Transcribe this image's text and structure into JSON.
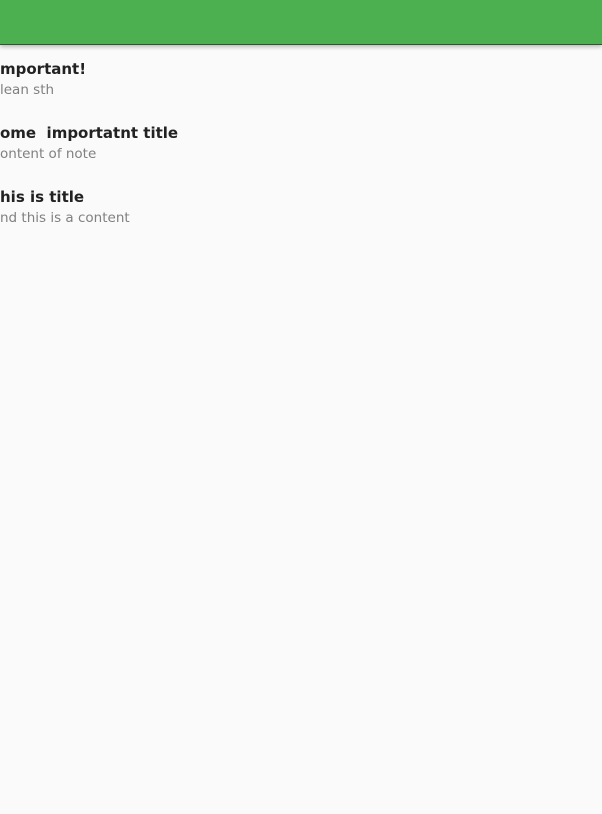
{
  "app_bar": {
    "color": "#4caf50"
  },
  "notes": [
    {
      "title": "mportant!",
      "content": "lean sth"
    },
    {
      "title": "ome  importatnt title",
      "content": "ontent of note"
    },
    {
      "title": "his is title",
      "content": "nd this is a content"
    }
  ]
}
